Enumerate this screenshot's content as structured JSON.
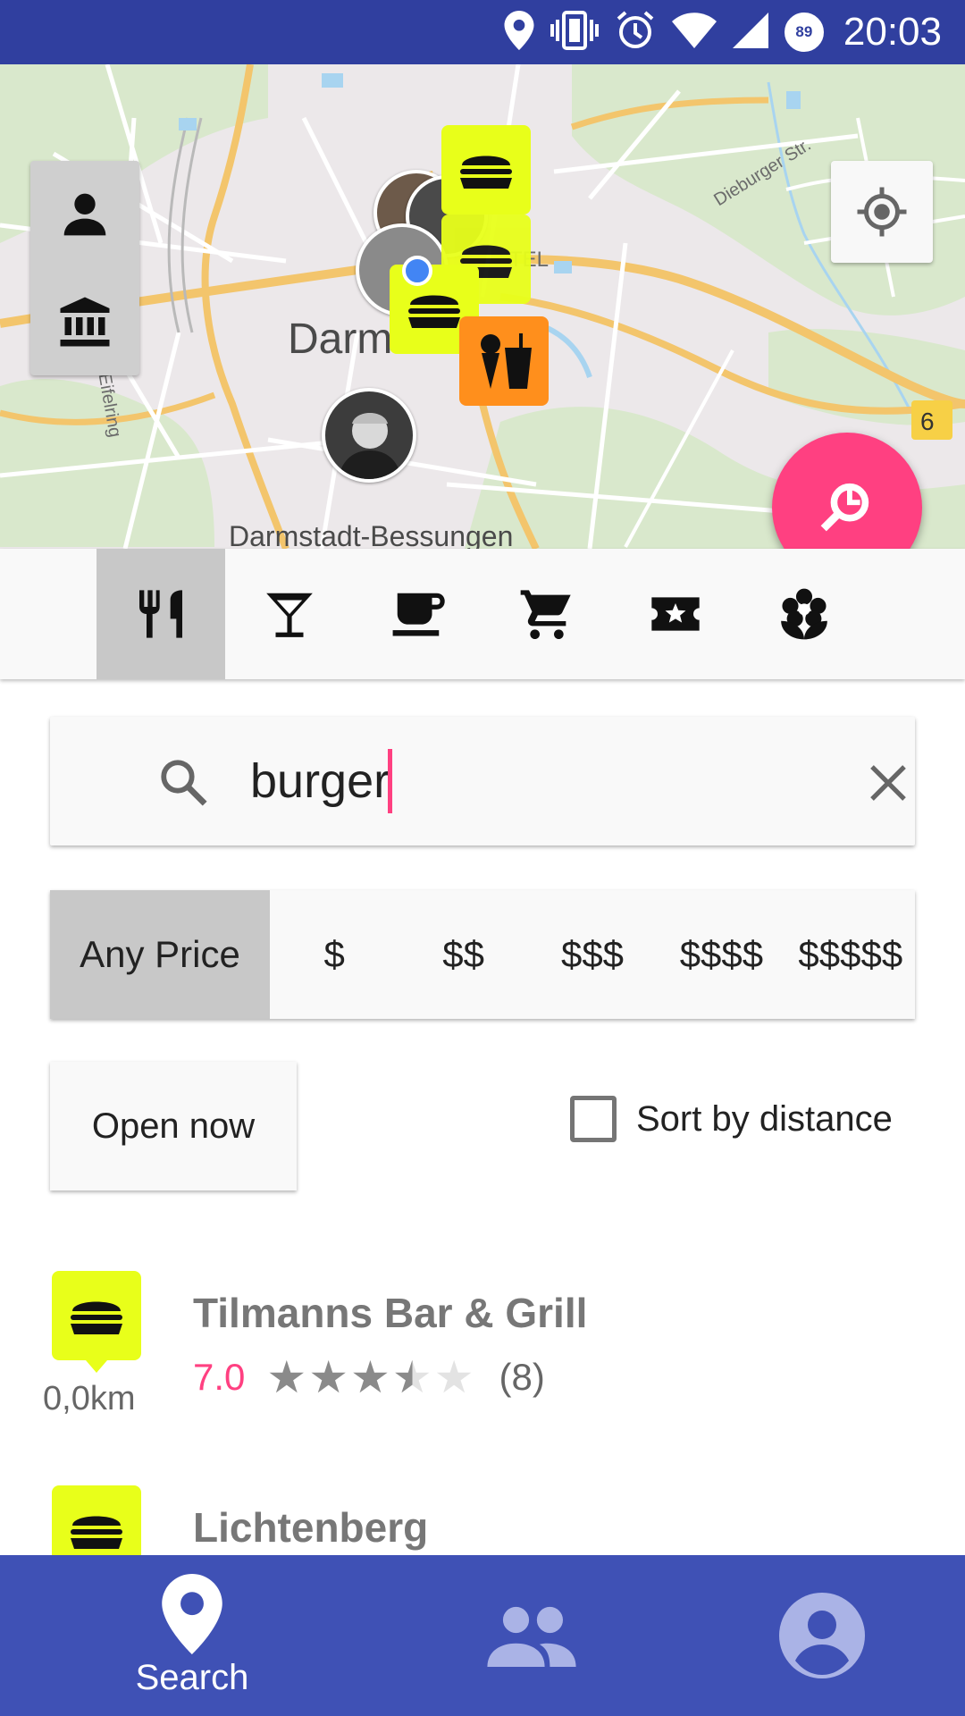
{
  "status_bar": {
    "time": "20:03",
    "battery": "89",
    "icons": [
      "location-icon",
      "vibrate-icon",
      "alarm-icon",
      "wifi-icon",
      "signal-icon",
      "battery-icon"
    ]
  },
  "map": {
    "labels": {
      "city": "Darmst",
      "district": "Darmstadt-Bessungen",
      "street_1": "Dieburger Str.",
      "street_2": "Eifelring",
      "hotel": "TEL"
    },
    "side_buttons": [
      "person-icon",
      "museum-icon"
    ],
    "locate_button": "my-location-icon",
    "fab_icon": "search-area-icon",
    "pins": [
      "burger-icon",
      "burger-icon",
      "burger-icon",
      "icecream-drink-icon",
      "avatar",
      "avatar",
      "avatar",
      "avatar"
    ]
  },
  "categories": [
    {
      "name": "restaurant",
      "icon": "fork-knife-icon",
      "active": true
    },
    {
      "name": "bar",
      "icon": "cocktail-icon",
      "active": false
    },
    {
      "name": "cafe",
      "icon": "coffee-icon",
      "active": false
    },
    {
      "name": "shopping",
      "icon": "cart-icon",
      "active": false
    },
    {
      "name": "events",
      "icon": "ticket-star-icon",
      "active": false
    },
    {
      "name": "nature",
      "icon": "flower-icon",
      "active": false
    }
  ],
  "search": {
    "value": "burger",
    "placeholder": ""
  },
  "price": {
    "options": [
      "Any Price",
      "$",
      "$$",
      "$$$",
      "$$$$",
      "$$$$$"
    ],
    "selected": "Any Price"
  },
  "filters": {
    "open_now_label": "Open now",
    "sort_label": "Sort by distance",
    "sort_checked": false
  },
  "results": [
    {
      "name": "Tilmanns Bar & Grill",
      "distance": "0,0km",
      "score": "7.0",
      "stars": 3.5,
      "reviews": "(8)",
      "icon": "burger-icon"
    },
    {
      "name": "Lichtenberg",
      "distance": "",
      "score": "",
      "stars": null,
      "reviews": "",
      "icon": "burger-icon"
    }
  ],
  "bottom_nav": {
    "search_label": "Search",
    "items": [
      "location-pin-icon",
      "people-icon",
      "account-icon"
    ]
  },
  "colors": {
    "status_bar": "#303f9f",
    "nav": "#3f51b5",
    "accent": "#ff4081",
    "burger_pin": "#e8ff1a",
    "icecream_pin": "#ff8f1c"
  }
}
